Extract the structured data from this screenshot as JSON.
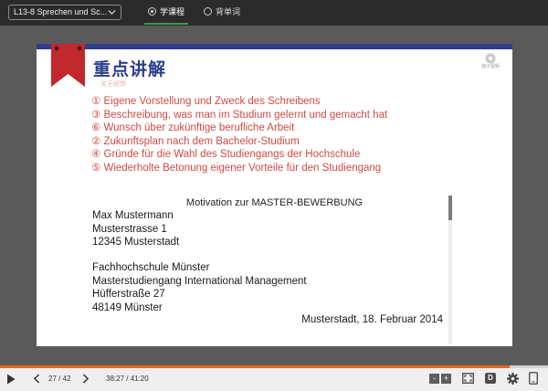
{
  "topbar": {
    "course_select": "L13-8 Sprechen und Sc...",
    "tabs": [
      {
        "label": "学课程",
        "active": true
      },
      {
        "label": "背单词",
        "active": false
      }
    ],
    "accent_color": "#3c9b4c"
  },
  "slide": {
    "title": "重点讲解",
    "subtitle": "关于纽带",
    "logo_text": "独子视频",
    "points": [
      "① Eigene Vorstellung und Zweck des Schreibens",
      "③ Beschreibung, was man im Studium gelernt und gemacht hat",
      "⑥ Wunsch über zukünftige berufliche Arbeit",
      "② Zukunftsplan nach dem Bachelor-Studium",
      "④ Gründe für die Wahl des Studiengangs der Hochschule",
      "⑤ Wiederholte Betonung eigener Vorteile für den Studiengang"
    ],
    "letter": {
      "title": "Motivation zur MASTER-BEWERBUNG",
      "sender": [
        "Max Mustermann",
        "Musterstrasse 1",
        "12345 Musterstadt",
        ""
      ],
      "recipient": [
        "Fachhochschule Münster",
        "Masterstudiengang International Management",
        "Hüfferstraße 27",
        "48149 Münster"
      ],
      "date": "Musterstadt, 18. Februar 2014"
    },
    "brand_color": "#2e3b8f",
    "point_color": "#d04a44",
    "bookmark_color": "#c0282e"
  },
  "player": {
    "page_counter": "27 / 42",
    "time_counter": "38:27 / 41:20",
    "progress_fraction": 0.93,
    "progress_color": "#e56b1e",
    "zoom_minus": "-",
    "zoom_plus": "+",
    "d_label": "D",
    "icons": [
      "play-icon",
      "prev-page-icon",
      "next-page-icon",
      "fit-screen-icon",
      "settings-icon",
      "fullscreen-icon"
    ]
  }
}
